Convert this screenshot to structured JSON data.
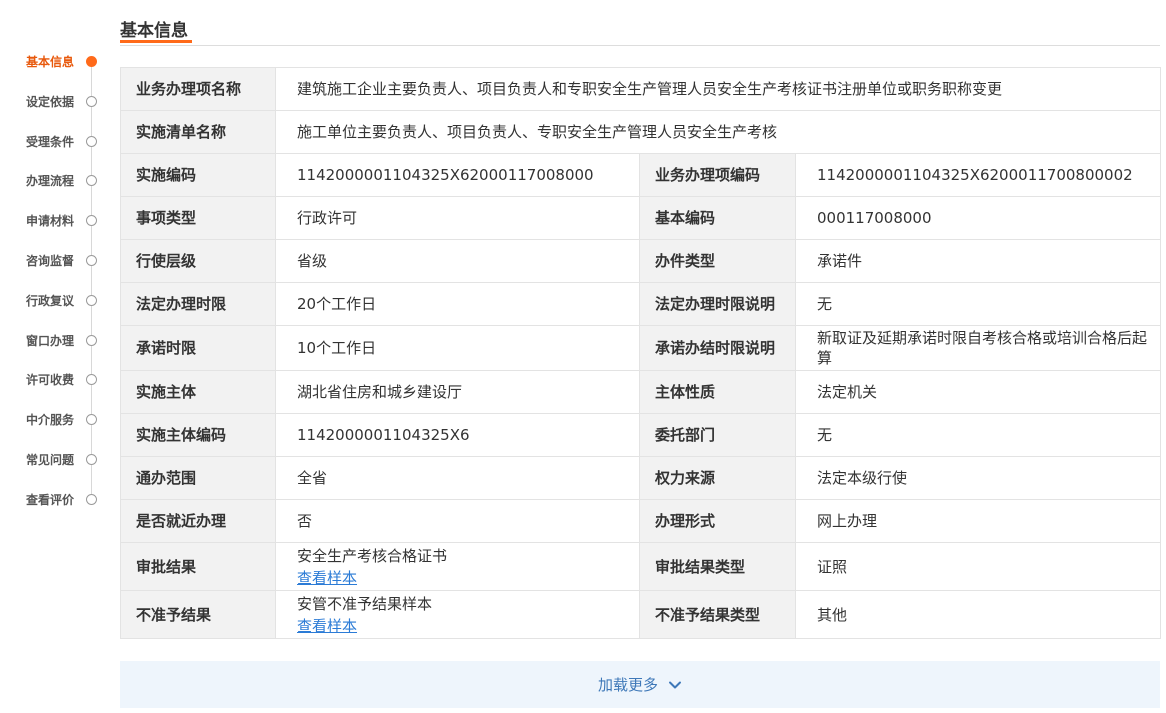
{
  "nav": {
    "items": [
      {
        "label": "基本信息",
        "active": true
      },
      {
        "label": "设定依据",
        "active": false
      },
      {
        "label": "受理条件",
        "active": false
      },
      {
        "label": "办理流程",
        "active": false
      },
      {
        "label": "申请材料",
        "active": false
      },
      {
        "label": "咨询监督",
        "active": false
      },
      {
        "label": "行政复议",
        "active": false
      },
      {
        "label": "窗口办理",
        "active": false
      },
      {
        "label": "许可收费",
        "active": false
      },
      {
        "label": "中介服务",
        "active": false
      },
      {
        "label": "常见问题",
        "active": false
      },
      {
        "label": "查看评价",
        "active": false
      }
    ]
  },
  "section": {
    "title": "基本信息"
  },
  "info": {
    "business_item_name": {
      "label": "业务办理项名称",
      "value": "建筑施工企业主要负责人、项目负责人和专职安全生产管理人员安全生产考核证书注册单位或职务职称变更"
    },
    "list_name": {
      "label": "实施清单名称",
      "value": "施工单位主要负责人、项目负责人、专职安全生产管理人员安全生产考核"
    },
    "impl_code": {
      "label": "实施编码",
      "value": "1142000001104325X62000117008000"
    },
    "business_item_code": {
      "label": "业务办理项编码",
      "value": "1142000001104325X6200011700800002"
    },
    "item_type": {
      "label": "事项类型",
      "value": "行政许可"
    },
    "base_code": {
      "label": "基本编码",
      "value": "000117008000"
    },
    "exercise_level": {
      "label": "行使层级",
      "value": "省级"
    },
    "case_type": {
      "label": "办件类型",
      "value": "承诺件"
    },
    "legal_limit": {
      "label": "法定办理时限",
      "value": "20个工作日"
    },
    "legal_limit_desc": {
      "label": "法定办理时限说明",
      "value": "无"
    },
    "promise_limit": {
      "label": "承诺时限",
      "value": "10个工作日"
    },
    "promise_limit_desc": {
      "label": "承诺办结时限说明",
      "value": "新取证及延期承诺时限自考核合格或培训合格后起算"
    },
    "impl_subject": {
      "label": "实施主体",
      "value": "湖北省住房和城乡建设厅"
    },
    "subject_nature": {
      "label": "主体性质",
      "value": "法定机关"
    },
    "subject_code": {
      "label": "实施主体编码",
      "value": "1142000001104325X6"
    },
    "entrusted_dept": {
      "label": "委托部门",
      "value": "无"
    },
    "scope": {
      "label": "通办范围",
      "value": "全省"
    },
    "power_source": {
      "label": "权力来源",
      "value": "法定本级行使"
    },
    "nearby": {
      "label": "是否就近办理",
      "value": "否"
    },
    "handle_form": {
      "label": "办理形式",
      "value": "网上办理"
    },
    "approval_result": {
      "label": "审批结果",
      "value": "安全生产考核合格证书",
      "link": "查看样本"
    },
    "approval_result_type": {
      "label": "审批结果类型",
      "value": "证照"
    },
    "reject_result": {
      "label": "不准予结果",
      "value": "安管不准予结果样本",
      "link": "查看样本"
    },
    "reject_result_type": {
      "label": "不准予结果类型",
      "value": "其他"
    }
  },
  "load_more": {
    "label": "加载更多"
  }
}
